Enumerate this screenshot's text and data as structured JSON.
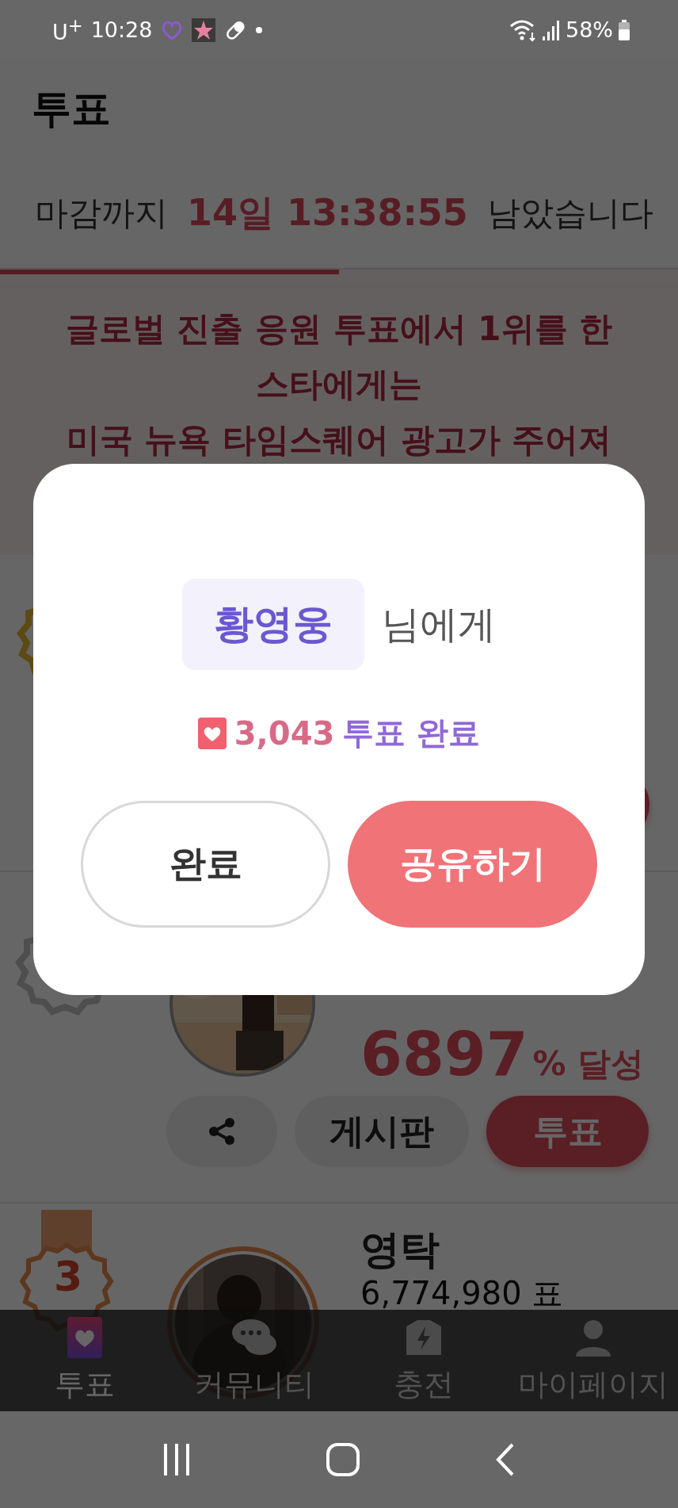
{
  "status_bar": {
    "carrier": "U$^{+}$",
    "time": "10:28",
    "battery": "58%"
  },
  "header": {
    "title": "투표"
  },
  "countdown": {
    "prefix": "마감까지",
    "remaining": "14일 13:38:55",
    "suffix": "남았습니다",
    "level": 0.5
  },
  "banner": {
    "lines": [
      "글로벌 진출 응원 투표에서 1위를 한",
      "스타에게는",
      "미국 뉴욕 타임스퀘어 광고가 주어져"
    ]
  },
  "ranking": [
    {
      "kind": "covered"
    },
    {
      "kind": "lower",
      "percent": "6897",
      "percent_unit": "% 달성",
      "board_button": "게시판",
      "vote_button": "투표"
    },
    {
      "kind": "upper",
      "rank": "3",
      "name": "영탁",
      "votes": "6,774,980 표"
    }
  ],
  "dialog": {
    "name": "황영웅",
    "name_suffix": "님에게",
    "vote_count": "3,043",
    "vote_text": "투표 완료",
    "buttons": [
      "완료",
      "공유하기"
    ]
  },
  "tab_bar": [
    {
      "label": "투표",
      "selected": true
    },
    {
      "label": "커뮤니티",
      "selected": false
    },
    {
      "label": "충전",
      "selected": false
    },
    {
      "label": "마이페이지",
      "selected": false
    }
  ]
}
